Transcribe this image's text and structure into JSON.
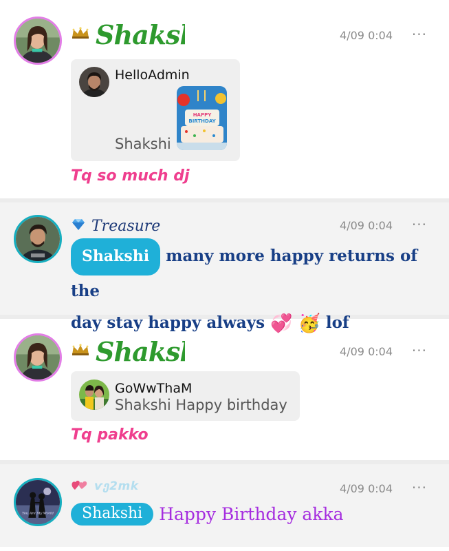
{
  "messages": [
    {
      "sender": "Shakshi",
      "badge": "crown-icon",
      "time": "4/09 0:04",
      "quote": {
        "user": "HelloAdmin",
        "text": "Shakshi",
        "image": "birthday-cake-image",
        "cake_text": "HAPPY BIRTHDAY"
      },
      "reply": "Tq so much dj"
    },
    {
      "sender": "Treasure",
      "badge": "diamond-icon",
      "time": "4/09 0:04",
      "mention": "Shakshi",
      "text_line1": "many more happy returns of the",
      "text_line2": "day stay happy always",
      "emoji1": "💞",
      "emoji2": "🥳",
      "text_end": "lof"
    },
    {
      "sender": "Shakshi",
      "badge": "crown-icon",
      "time": "4/09 0:04",
      "quote": {
        "user": "GoWwThaM",
        "text": "Shakshi Happy birthday"
      },
      "reply": "Tq pakko"
    },
    {
      "sender": "ѵე2mk",
      "badge": "hearts-icon",
      "time": "4/09 0:04",
      "mention": "Shakshi",
      "text": "Happy Birthday akka",
      "avatar_text": "You Are My World"
    }
  ],
  "more_label": "···",
  "colors": {
    "accent_green": "#2e9a2e",
    "accent_pink": "#ef3e8e",
    "mention_bg": "#1fb0d8",
    "navy": "#183f86",
    "purple": "#a52ddf"
  }
}
